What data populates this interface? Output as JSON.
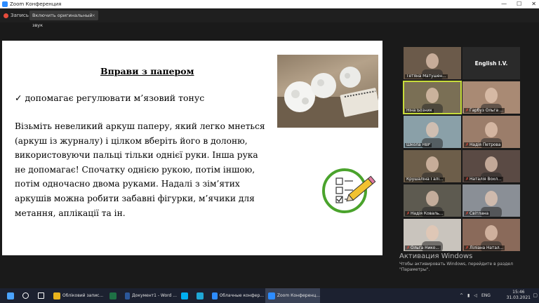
{
  "window": {
    "title": "Zoom Конференция",
    "controls": [
      "—",
      "☐",
      "✕"
    ]
  },
  "toolbar": {
    "rec_label": "Запись",
    "original_sound_label": "Включить оригинальный звук",
    "original_sound_close": "×"
  },
  "slide": {
    "title": "Вправи з папером",
    "bullet": "✓ допомагає регулювати м’язовий тонус",
    "paragraph": "Візьміть невеликий аркуш паперу, який  легко мнеться\n(аркуш із журналу) і цілком вберіть його в долоню,\nвикористовуючи пальці тільки однієї руки. Інша рука\nне допомагає! Спочатку однією рукою, потім іншою,\nпотім одночасно двома руками. Надалі з зім’ятих\nаркушів можна робити забавні фігурки, м’ячики для\nметання, аплікації та ін."
  },
  "participants": [
    {
      "name": "Тетяна Матушен...",
      "muted": false,
      "active": false,
      "bg": "#6b5a4a"
    },
    {
      "name": "English I.V.",
      "muted": false,
      "active": false,
      "bg": "#2a2a2a",
      "avatar_only": true
    },
    {
      "name": "Ніна Бозник",
      "muted": false,
      "active": true,
      "bg": "#7a6f55"
    },
    {
      "name": "Гарбуз Ольга ...",
      "muted": true,
      "active": false,
      "bg": "#a98a74"
    },
    {
      "name": "Школа НВР",
      "muted": false,
      "active": false,
      "bg": "#8aa0a8"
    },
    {
      "name": "Надія Петрова",
      "muted": true,
      "active": false,
      "bg": "#9b7d6a"
    },
    {
      "name": "Крушаліна Галі...",
      "muted": false,
      "active": false,
      "bg": "#6d5e4a"
    },
    {
      "name": "Наталія Вохл...",
      "muted": true,
      "active": false,
      "bg": "#5a4a44"
    },
    {
      "name": "Надія Коваль...",
      "muted": true,
      "active": false,
      "bg": "#5d5a50"
    },
    {
      "name": "Світлана",
      "muted": true,
      "active": false,
      "bg": "#8a8f96"
    },
    {
      "name": "Ольга Нико...",
      "muted": true,
      "active": false,
      "bg": "#c9c4bd"
    },
    {
      "name": "Ліліана Натал...",
      "muted": true,
      "active": false,
      "bg": "#8a6a5a"
    }
  ],
  "watermark": {
    "line1": "Активация Windows",
    "line2": "Чтобы активировать Windows, перейдите в раздел \"Параметры\"."
  },
  "taskbar": {
    "items": [
      {
        "label": "",
        "icon": "windows-icon",
        "color": "#4aa3ff"
      },
      {
        "label": "",
        "icon": "search-icon",
        "color": "#ffffff"
      },
      {
        "label": "",
        "icon": "task-view-icon",
        "color": "#ffffff"
      },
      {
        "label": "Облiковий запис...",
        "icon": "chrome-icon",
        "color": "#e8b31c"
      },
      {
        "label": "",
        "icon": "excel-icon",
        "color": "#1e7145"
      },
      {
        "label": "Документ1 - Word ...",
        "icon": "word-icon",
        "color": "#2b579a"
      },
      {
        "label": "",
        "icon": "skype-icon",
        "color": "#00aff0"
      },
      {
        "label": "",
        "icon": "edge-icon",
        "color": "#1fa7d6"
      },
      {
        "label": "Облачные конфер...",
        "icon": "zoom-icon",
        "color": "#2d8cff"
      },
      {
        "label": "Zoom Конференц...",
        "icon": "zoom-icon",
        "color": "#2d8cff",
        "active": true
      }
    ],
    "tray_language": "ENG",
    "time": "15:46",
    "date": "31.03.2021"
  }
}
